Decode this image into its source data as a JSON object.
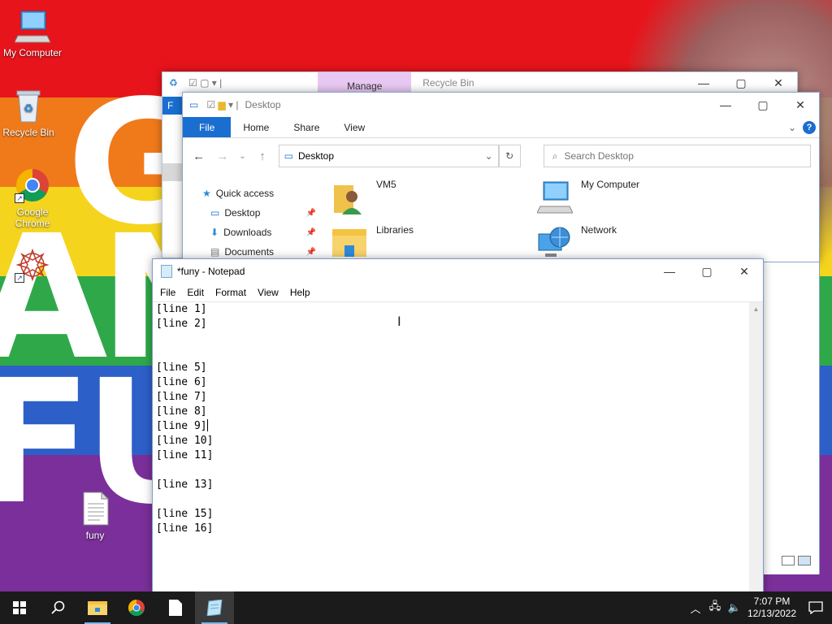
{
  "desktop": {
    "icons": [
      {
        "label": "My Computer",
        "icon": "computer-icon"
      },
      {
        "label": "Recycle Bin",
        "icon": "recycle-bin-icon"
      },
      {
        "label": "Google Chrome",
        "icon": "chrome-icon"
      },
      {
        "label": "",
        "icon": "app-shortcut-icon"
      },
      {
        "label": "funy",
        "icon": "text-file-icon"
      }
    ]
  },
  "recycle_window": {
    "manage_label": "Manage",
    "title": "Recycle Bin",
    "file_tab": "F"
  },
  "explorer": {
    "title": "Desktop",
    "tabs": [
      "File",
      "Home",
      "Share",
      "View"
    ],
    "address": "Desktop",
    "search_placeholder": "Search Desktop",
    "nav": {
      "quick_access": "Quick access",
      "items": [
        "Desktop",
        "Downloads",
        "Documents"
      ]
    },
    "content": [
      "VM5",
      "My Computer",
      "Libraries",
      "Network"
    ]
  },
  "notepad": {
    "title": "*funy - Notepad",
    "menu": [
      "File",
      "Edit",
      "Format",
      "View",
      "Help"
    ],
    "lines_before_caret": "[line 1]\n[line 2]\n\n\n[line 5]\n[line 6]\n[line 7]\n[line 8]\n[line 9]",
    "lines_after_caret": "\n[line 10]\n[line 11]\n\n[line 13]\n\n[line 15]\n[line 16]"
  },
  "taskbar": {
    "time": "7:07 PM",
    "date": "12/13/2022",
    "pinned": [
      "start-icon",
      "search-icon",
      "file-explorer-icon",
      "chrome-icon",
      "file-icon",
      "notepad-icon"
    ]
  },
  "colors": {
    "accent": "#1a6ed0",
    "taskbar": "#1b1b1b",
    "manage_tab": "#e8c8f2"
  }
}
